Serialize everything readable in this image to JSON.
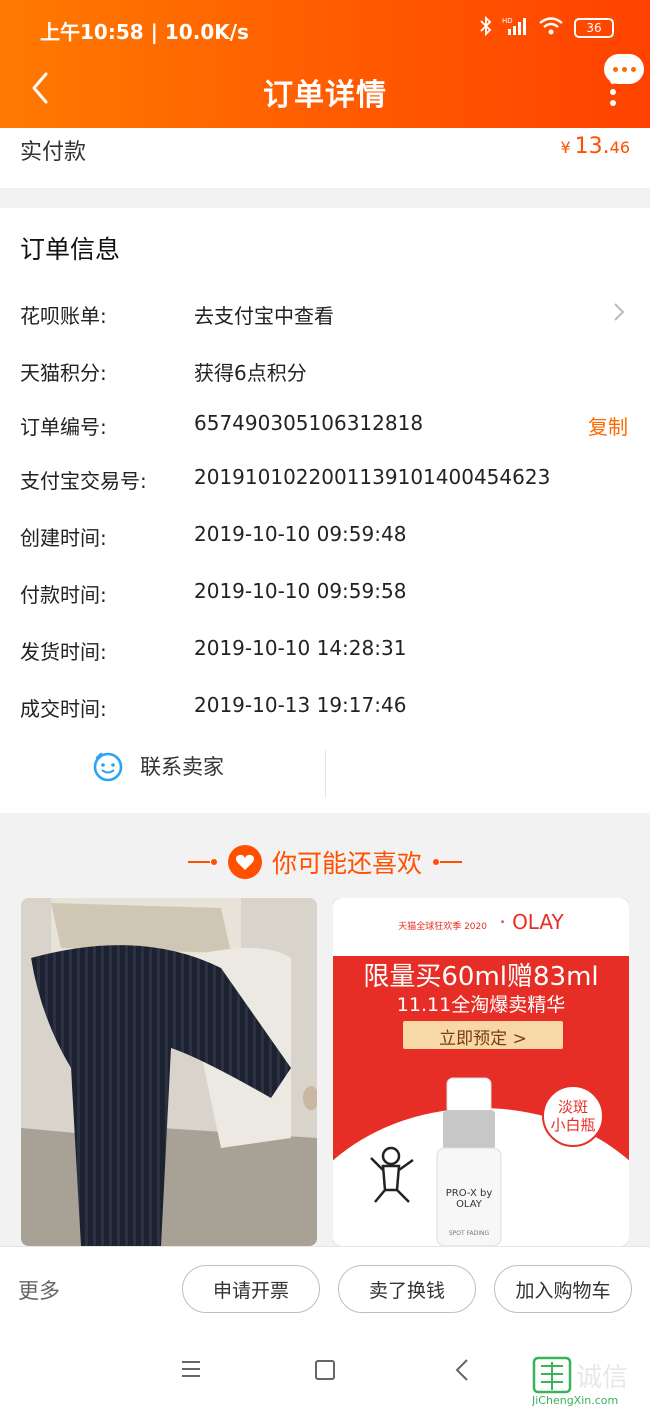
{
  "status_bar": {
    "time_text": "上午10:58 | 10.0K/s",
    "battery": "36",
    "hd": "HD"
  },
  "header": {
    "title": "订单详情"
  },
  "payment": {
    "label": "实付款",
    "currency": "¥",
    "amount_int": "13.",
    "amount_dec": "46"
  },
  "order_info": {
    "title": "订单信息",
    "rows": [
      {
        "key": "花呗账单:",
        "value": "去支付宝中查看"
      },
      {
        "key": "天猫积分:",
        "value": "获得6点积分"
      },
      {
        "key": "订单编号:",
        "value": "657490305106312818"
      },
      {
        "key": "支付宝交易号:",
        "value": "2019101022001139101400454623"
      },
      {
        "key": "创建时间:",
        "value": "2019-10-10 09:59:48"
      },
      {
        "key": "付款时间:",
        "value": "2019-10-10 09:59:58"
      },
      {
        "key": "发货时间:",
        "value": "2019-10-10 14:28:31"
      },
      {
        "key": "成交时间:",
        "value": "2019-10-13 19:17:46"
      }
    ],
    "copy_label": "复制",
    "contact_label": "联系卖家"
  },
  "recommend": {
    "title": "你可能还喜欢",
    "ad": {
      "event": "天猫全球狂欢季 2020",
      "brand": "OLAY",
      "headline": "限量买60ml赠83ml",
      "subline": "11.11全淘爆卖精华",
      "cta": "立即预定 >",
      "badge_line1": "淡斑",
      "badge_line2": "小白瓶",
      "bottle_text": "PRO-X by OLAY",
      "bottle_small": "SPOT FADING"
    }
  },
  "actions": {
    "more": "更多",
    "invoice": "申请开票",
    "resell": "卖了换钱",
    "add_cart": "加入购物车"
  },
  "watermark": {
    "main": "诚信",
    "url": "JiChengXin.com"
  },
  "colors": {
    "accent": "#ff5000",
    "header_start": "#ff7a00",
    "header_end": "#ff4200"
  }
}
